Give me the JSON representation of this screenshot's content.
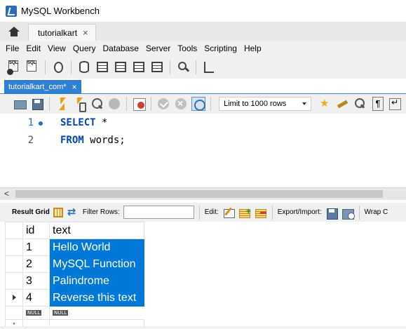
{
  "window": {
    "title": "MySQL Workbench"
  },
  "home_tabs": {
    "connection_tab": "tutorialkart",
    "close_glyph": "×"
  },
  "menu": [
    "File",
    "Edit",
    "View",
    "Query",
    "Database",
    "Server",
    "Tools",
    "Scripting",
    "Help"
  ],
  "main_toolbar": {
    "icons": [
      "new-sql-tab-icon",
      "open-sql-script-icon",
      "inspector-icon",
      "create-schema-icon",
      "create-table-icon",
      "create-view-icon",
      "create-procedure-icon",
      "create-function-icon",
      "search-table-data-icon",
      "reconnect-icon"
    ]
  },
  "query_tab": {
    "label": "tutorialkart_com*",
    "close_glyph": "×"
  },
  "sql_toolbar": {
    "limit_label": "Limit to 1000 rows"
  },
  "editor": {
    "lines": [
      {
        "number": "1",
        "keyword": "SELECT",
        "rest": " *"
      },
      {
        "number": "2",
        "keyword": "FROM",
        "rest": " words;"
      }
    ]
  },
  "scroll": {
    "left_arrow": "<"
  },
  "result_toolbar": {
    "result_grid_label": "Result Grid",
    "filter_label": "Filter Rows:",
    "filter_value": "",
    "edit_label": "Edit:",
    "export_label": "Export/Import:",
    "wrap_label": "Wrap C"
  },
  "result_grid": {
    "columns": [
      "id",
      "text"
    ],
    "rows": [
      {
        "id": "1",
        "text": "Hello World"
      },
      {
        "id": "2",
        "text": "MySQL Function"
      },
      {
        "id": "3",
        "text": "Palindrome"
      },
      {
        "id": "4",
        "text": "Reverse this text"
      }
    ],
    "null_label": "NULL",
    "new_row_marker": "*"
  },
  "colors": {
    "selection": "#0078d7",
    "keyword": "#0046b0",
    "active_line": "#1b6ed6",
    "query_tab": "#2f7fd3"
  }
}
